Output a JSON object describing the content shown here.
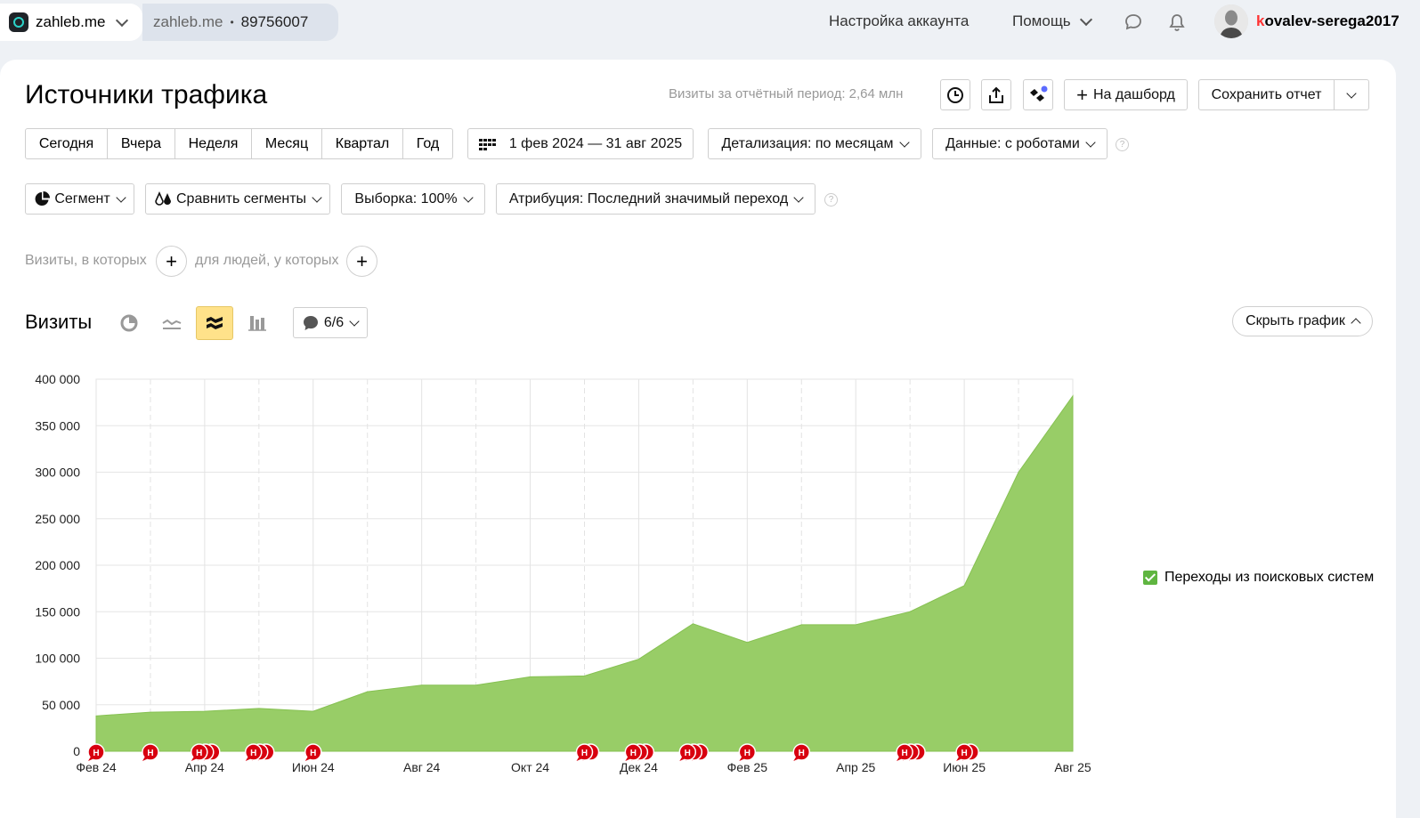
{
  "topbar": {
    "site_name": "zahleb.me",
    "counter_site": "zahleb.me",
    "counter_sep": "•",
    "counter_id": "89756007",
    "account_settings": "Настройка аккаунта",
    "help": "Помощь",
    "username_first": "k",
    "username_rest": "ovalev-serega2017"
  },
  "header": {
    "title": "Источники трафика",
    "visits_hint": "Визиты за отчётный период: 2,64 млн",
    "add_dashboard": "На дашборд",
    "save_report": "Сохранить отчет"
  },
  "periods": [
    "Сегодня",
    "Вчера",
    "Неделя",
    "Месяц",
    "Квартал",
    "Год"
  ],
  "date_range": "1 фев 2024 — 31 авг 2025",
  "detail": "Детализация: по месяцам",
  "data_mode": "Данные: с роботами",
  "filters": {
    "segment": "Сегмент",
    "compare": "Сравнить сегменты",
    "sample": "Выборка: 100%",
    "attribution": "Атрибуция: Последний значимый переход"
  },
  "conditions": {
    "visits_where": "Визиты, в которых",
    "people_where": "для людей, у которых"
  },
  "chart_header": {
    "title": "Визиты",
    "notes": "6/6",
    "hide_chart": "Скрыть график"
  },
  "legend_label": "Переходы из поисковых систем",
  "note_marker": "Н",
  "colors": {
    "area": "#98cd67",
    "area_line": "#86c152",
    "marker": "#d8000f",
    "active_btn": "#ffe28a"
  },
  "chart_data": {
    "type": "area",
    "x": [
      "Фев 24",
      "Мар 24",
      "Апр 24",
      "Май 24",
      "Июн 24",
      "Июл 24",
      "Авг 24",
      "Сен 24",
      "Окт 24",
      "Ноя 24",
      "Дек 24",
      "Янв 25",
      "Фев 25",
      "Мар 25",
      "Апр 25",
      "Май 25",
      "Июн 25",
      "Июл 25",
      "Авг 25"
    ],
    "x_tick_labels": [
      "Фев 24",
      "Апр 24",
      "Июн 24",
      "Авг 24",
      "Окт 24",
      "Дек 24",
      "Фев 25",
      "Апр 25",
      "Июн 25",
      "Авг 25"
    ],
    "series": [
      {
        "name": "Переходы из поисковых систем",
        "values": [
          38000,
          42000,
          43000,
          46000,
          43000,
          64000,
          71000,
          71000,
          80000,
          81000,
          99000,
          137000,
          117000,
          136000,
          136000,
          150000,
          178000,
          300000,
          382000
        ]
      }
    ],
    "ylim": [
      0,
      400000
    ],
    "y_ticks": [
      "0",
      "50 000",
      "100 000",
      "150 000",
      "200 000",
      "250 000",
      "300 000",
      "350 000",
      "400 000"
    ],
    "y_tick_values": [
      0,
      50000,
      100000,
      150000,
      200000,
      250000,
      300000,
      350000,
      400000
    ],
    "note_month_index": [
      0,
      1,
      1.9,
      2.9,
      4,
      9,
      9.9,
      10.9,
      12,
      13,
      14.9,
      16
    ],
    "note_stack_count": [
      1,
      1,
      3,
      3,
      1,
      2,
      3,
      3,
      1,
      1,
      3,
      2
    ],
    "grid": true,
    "legend_position": "right"
  }
}
